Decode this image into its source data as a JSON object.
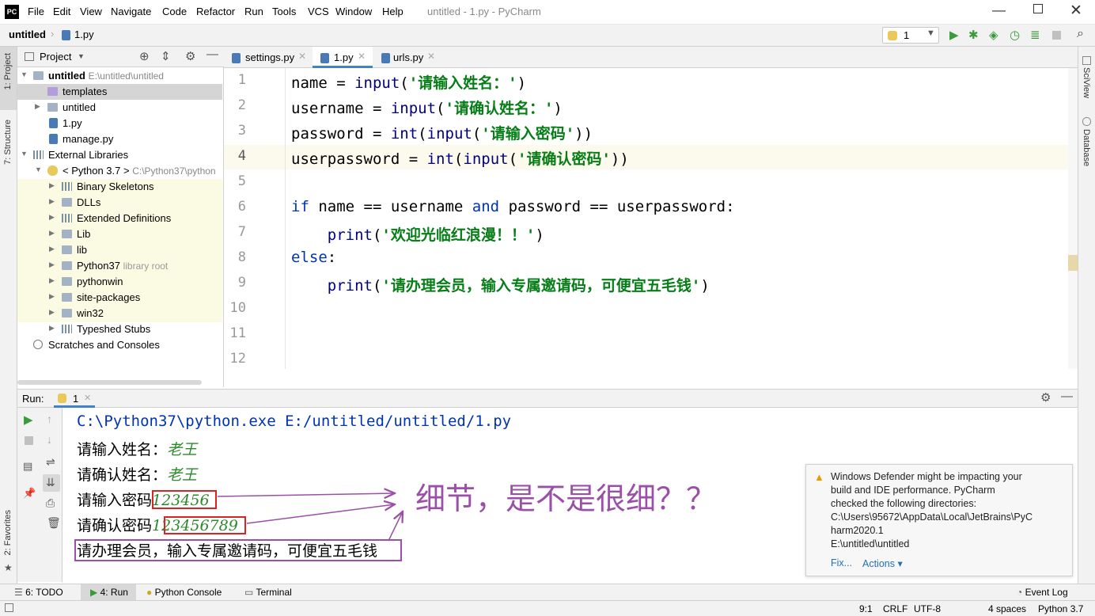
{
  "app": {
    "logo": "PC",
    "title": "untitled - 1.py - PyCharm",
    "menu": [
      "File",
      "Edit",
      "View",
      "Navigate",
      "Code",
      "Refactor",
      "Run",
      "Tools",
      "VCS",
      "Window",
      "Help"
    ]
  },
  "navbar": {
    "breadcrumb_project": "untitled",
    "breadcrumb_file": "1.py",
    "run_config": "1"
  },
  "left_strip": {
    "project": "1: Project",
    "structure": "7: Structure",
    "favorites": "2: Favorites"
  },
  "right_strip": {
    "sciview": "SciView",
    "database": "Database"
  },
  "project_panel": {
    "header": "Project",
    "tree": [
      {
        "label": "untitled",
        "hint": "E:\\untitled\\untitled"
      },
      {
        "label": "templates"
      },
      {
        "label": "untitled"
      },
      {
        "label": "1.py"
      },
      {
        "label": "manage.py"
      },
      {
        "label": "External Libraries"
      },
      {
        "label": "< Python 3.7 >",
        "hint": "C:\\Python37\\python"
      },
      {
        "label": "Binary Skeletons"
      },
      {
        "label": "DLLs"
      },
      {
        "label": "Extended Definitions"
      },
      {
        "label": "Lib"
      },
      {
        "label": "lib"
      },
      {
        "label": "Python37",
        "hint": "library root"
      },
      {
        "label": "pythonwin"
      },
      {
        "label": "site-packages"
      },
      {
        "label": "win32"
      },
      {
        "label": "Typeshed Stubs"
      },
      {
        "label": "Scratches and Consoles"
      }
    ]
  },
  "editor": {
    "tabs": [
      "settings.py",
      "1.py",
      "urls.py"
    ],
    "line_numbers": [
      "1",
      "2",
      "3",
      "4",
      "5",
      "6",
      "7",
      "8",
      "9",
      "10",
      "11",
      "12"
    ],
    "code": {
      "l1": {
        "a": "name = ",
        "b": "input",
        "c": "(",
        "d": "'请输入姓名：'",
        "e": ")"
      },
      "l2": {
        "a": "username = ",
        "b": "input",
        "c": "(",
        "d": "'请确认姓名：'",
        "e": ")"
      },
      "l3": {
        "a": "password = ",
        "b": "int",
        "c": "(",
        "d": "input",
        "e": "(",
        "f": "'请输入密码'",
        "g": "))"
      },
      "l4": {
        "a": "userpassword = ",
        "b": "int",
        "c": "(",
        "d": "input",
        "e": "(",
        "f": "'请确认密码'",
        "g": "))"
      },
      "l6": {
        "a": "if",
        "b": " name == username ",
        "c": "and",
        "d": " password == userpassword:"
      },
      "l7": {
        "a": "    ",
        "b": "print",
        "c": "(",
        "d": "'欢迎光临红浪漫！！'",
        "e": ")"
      },
      "l8": {
        "a": "else",
        "b": ":"
      },
      "l9": {
        "a": "    ",
        "b": "print",
        "c": "(",
        "d": "'请办理会员，输入专属邀请码，可便宜五毛钱'",
        "e": ")"
      }
    }
  },
  "run_panel": {
    "label": "Run:",
    "tab": "1",
    "command": "C:\\Python37\\python.exe E:/untitled/untitled/1.py",
    "lines": [
      {
        "prompt": "请输入姓名：",
        "input": "老王"
      },
      {
        "prompt": "请确认姓名：",
        "input": "老王"
      },
      {
        "prompt": "请输入密码",
        "input": "123456"
      },
      {
        "prompt": "请确认密码",
        "input": "123456789"
      }
    ],
    "final": "请办理会员，输入专属邀请码，可便宜五毛钱",
    "annotation": "细节，是不是很细？？"
  },
  "notification": {
    "text": "Windows Defender might be impacting your\nbuild and IDE performance. PyCharm\nchecked the following directories:\nC:\\Users\\95672\\AppData\\Local\\JetBrains\\PyC\nharm2020.1\nE:\\untitled\\untitled",
    "fix": "Fix...",
    "actions": "Actions ▾"
  },
  "bottom_tabs": {
    "todo": "6: TODO",
    "run": "4: Run",
    "console": "Python Console",
    "terminal": "Terminal",
    "eventlog": "Event Log"
  },
  "status": {
    "position": "9:1",
    "line_sep": "CRLF",
    "encoding": "UTF-8",
    "indent": "4 spaces",
    "interpreter": "Python 3.7"
  },
  "colors": {
    "keyword": "#0033b3",
    "string": "#067d17",
    "annotation": "#9b4fa8",
    "red_box": "#d22222"
  }
}
